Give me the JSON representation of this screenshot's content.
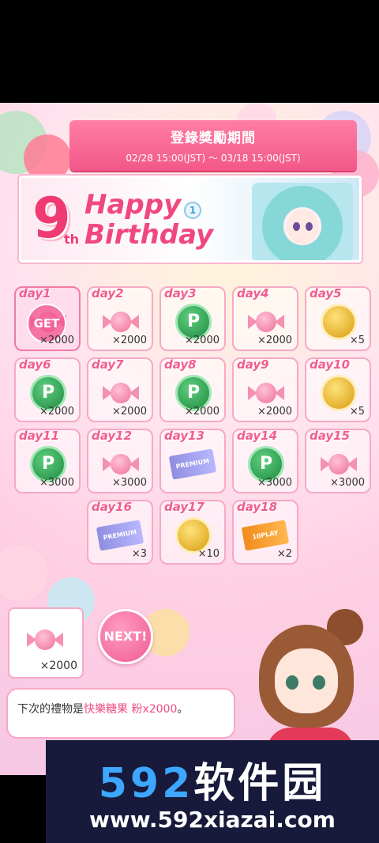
{
  "banner": {
    "title": "登錄獎勵期間",
    "period": "02/28 15:00(JST) ～ 03/18 15:00(JST)"
  },
  "hero": {
    "num": "9",
    "suffix": "th",
    "line1": "Happy",
    "line2": "Birthday",
    "badge": "1"
  },
  "days": [
    {
      "day": "day1",
      "icon": "candy",
      "qty": "×2000",
      "stamp": "GET"
    },
    {
      "day": "day2",
      "icon": "candy",
      "qty": "×2000"
    },
    {
      "day": "day3",
      "icon": "p-coin",
      "qty": "×2000"
    },
    {
      "day": "day4",
      "icon": "candy",
      "qty": "×2000"
    },
    {
      "day": "day5",
      "icon": "gold-coin",
      "qty": "×5"
    },
    {
      "day": "day6",
      "icon": "p-coin",
      "qty": "×2000"
    },
    {
      "day": "day7",
      "icon": "candy",
      "qty": "×2000"
    },
    {
      "day": "day8",
      "icon": "p-coin",
      "qty": "×2000"
    },
    {
      "day": "day9",
      "icon": "candy",
      "qty": "×2000"
    },
    {
      "day": "day10",
      "icon": "gold-coin",
      "qty": "×5"
    },
    {
      "day": "day11",
      "icon": "p-coin",
      "qty": "×3000"
    },
    {
      "day": "day12",
      "icon": "candy",
      "qty": "×3000"
    },
    {
      "day": "day13",
      "icon": "premium-ticket",
      "qty": "",
      "ticket_label": "PREMIUM"
    },
    {
      "day": "day14",
      "icon": "p-coin",
      "qty": "×3000"
    },
    {
      "day": "day15",
      "icon": "candy",
      "qty": "×3000"
    },
    {
      "day": "day16",
      "icon": "premium-ticket",
      "qty": "×3",
      "ticket_label": "PREMIUM"
    },
    {
      "day": "day17",
      "icon": "gold-coin",
      "qty": "×10"
    },
    {
      "day": "day18",
      "icon": "play-ticket",
      "qty": "×2",
      "ticket_label": "10PLAY"
    }
  ],
  "next_reward": {
    "qty": "×2000",
    "icon": "candy"
  },
  "next_button": "NEXT!",
  "message": {
    "prefix": "下次的禮物是",
    "item": "快樂糖果 粉x2000",
    "suffix": "。"
  },
  "watermark": {
    "main_num": "592",
    "main_cn": "软件园",
    "sub": "www.592xiazai.com"
  },
  "colors": {
    "accent_pink": "#f05d8f",
    "coin_green": "#1f8a42",
    "coin_gold": "#d79b0d"
  }
}
